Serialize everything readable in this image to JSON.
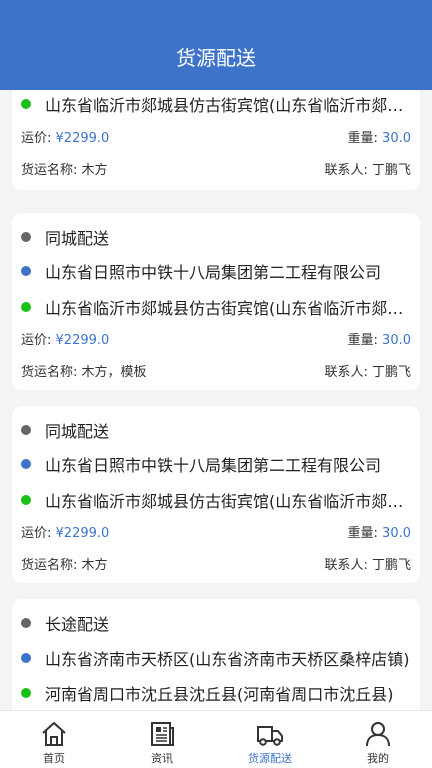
{
  "header": {
    "title": "货源配送"
  },
  "cards": [
    {
      "destination": "山东省临沂市郯城县仿古街宾馆(山东省临沂市郯城县仿古街宾馆)",
      "fee_label": "运价:",
      "fee": "¥2299.0",
      "weight_label": "重量:",
      "weight": "30.0",
      "goods_label": "货运名称:",
      "goods": "木方",
      "contact_label": "联系人:",
      "contact": "丁鹏飞"
    },
    {
      "type": "同城配送",
      "origin": "山东省日照市中铁十八局集团第二工程有限公司",
      "destination": "山东省临沂市郯城县仿古街宾馆(山东省临沂市郯城县仿古街宾馆)",
      "fee_label": "运价:",
      "fee": "¥2299.0",
      "weight_label": "重量:",
      "weight": "30.0",
      "goods_label": "货运名称:",
      "goods": "木方，模板",
      "contact_label": "联系人:",
      "contact": "丁鹏飞"
    },
    {
      "type": "同城配送",
      "origin": "山东省日照市中铁十八局集团第二工程有限公司",
      "destination": "山东省临沂市郯城县仿古街宾馆(山东省临沂市郯城县仿古街宾馆)",
      "fee_label": "运价:",
      "fee": "¥2299.0",
      "weight_label": "重量:",
      "weight": "30.0",
      "goods_label": "货运名称:",
      "goods": "木方",
      "contact_label": "联系人:",
      "contact": "丁鹏飞"
    },
    {
      "type": "长途配送",
      "origin": "山东省济南市天桥区(山东省济南市天桥区桑梓店镇)",
      "destination": "河南省周口市沈丘县沈丘县(河南省周口市沈丘县)"
    }
  ],
  "tabbar": {
    "items": [
      {
        "label": "首页",
        "icon": "home-icon"
      },
      {
        "label": "资讯",
        "icon": "news-icon"
      },
      {
        "label": "货源配送",
        "icon": "truck-icon",
        "active": true
      },
      {
        "label": "我的",
        "icon": "user-icon"
      }
    ],
    "active_color": "#3d74c9"
  },
  "colors": {
    "header": "#3d74c9",
    "origin_dot": "#3d74c9",
    "destination_dot": "#19c019",
    "type_dot": "#666666"
  }
}
